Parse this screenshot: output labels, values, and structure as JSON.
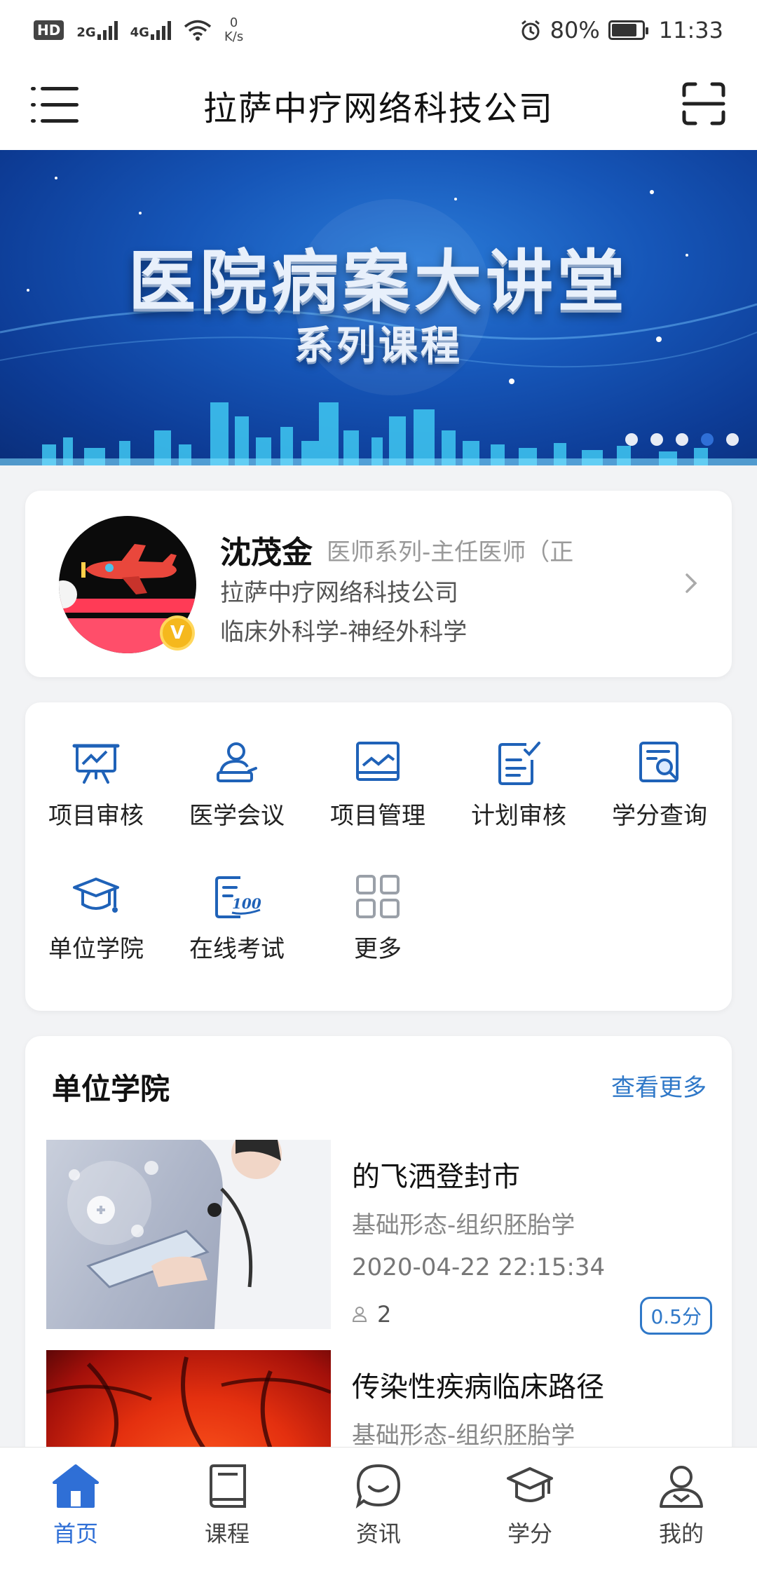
{
  "status_bar": {
    "hd": "HD",
    "sim1": "2G",
    "sim2": "4G",
    "speed_value": "0",
    "speed_unit": "K/s",
    "battery": "80%",
    "time": "11:33"
  },
  "header": {
    "title": "拉萨中疗网络科技公司"
  },
  "banner": {
    "title": "医院病案大讲堂",
    "subtitle": "系列课程",
    "dots": 5,
    "active_dot": 3
  },
  "profile": {
    "name": "沈茂金",
    "title": "医师系列-主任医师（正",
    "company": "拉萨中疗网络科技公司",
    "department": "临床外科学-神经外科学",
    "badge": "V"
  },
  "menu": {
    "items": [
      {
        "label": "项目审核",
        "icon": "presentation-icon"
      },
      {
        "label": "医学会议",
        "icon": "conference-icon"
      },
      {
        "label": "项目管理",
        "icon": "monitor-chart-icon"
      },
      {
        "label": "计划审核",
        "icon": "checklist-icon"
      },
      {
        "label": "学分查询",
        "icon": "search-document-icon"
      },
      {
        "label": "单位学院",
        "icon": "graduation-cap-icon"
      },
      {
        "label": "在线考试",
        "icon": "exam-score-icon"
      },
      {
        "label": "更多",
        "icon": "grid-icon"
      }
    ]
  },
  "section": {
    "title": "单位学院",
    "more": "查看更多",
    "courses": [
      {
        "title": "的飞洒登封市",
        "category": "基础形态-组织胚胎学",
        "time": "2020-04-22 22:15:34",
        "people": "2",
        "score": "0.5分"
      },
      {
        "title": "传染性疾病临床路径",
        "category": "基础形态-组织胚胎学"
      }
    ]
  },
  "tabs": [
    {
      "label": "首页",
      "icon": "home-icon",
      "active": true
    },
    {
      "label": "课程",
      "icon": "book-icon",
      "active": false
    },
    {
      "label": "资讯",
      "icon": "chat-icon",
      "active": false
    },
    {
      "label": "学分",
      "icon": "graduation-cap-icon",
      "active": false
    },
    {
      "label": "我的",
      "icon": "user-icon",
      "active": false
    }
  ],
  "colors": {
    "accent": "#2f6fd6",
    "icon_blue": "#1f62b8",
    "link": "#2f78c8"
  }
}
